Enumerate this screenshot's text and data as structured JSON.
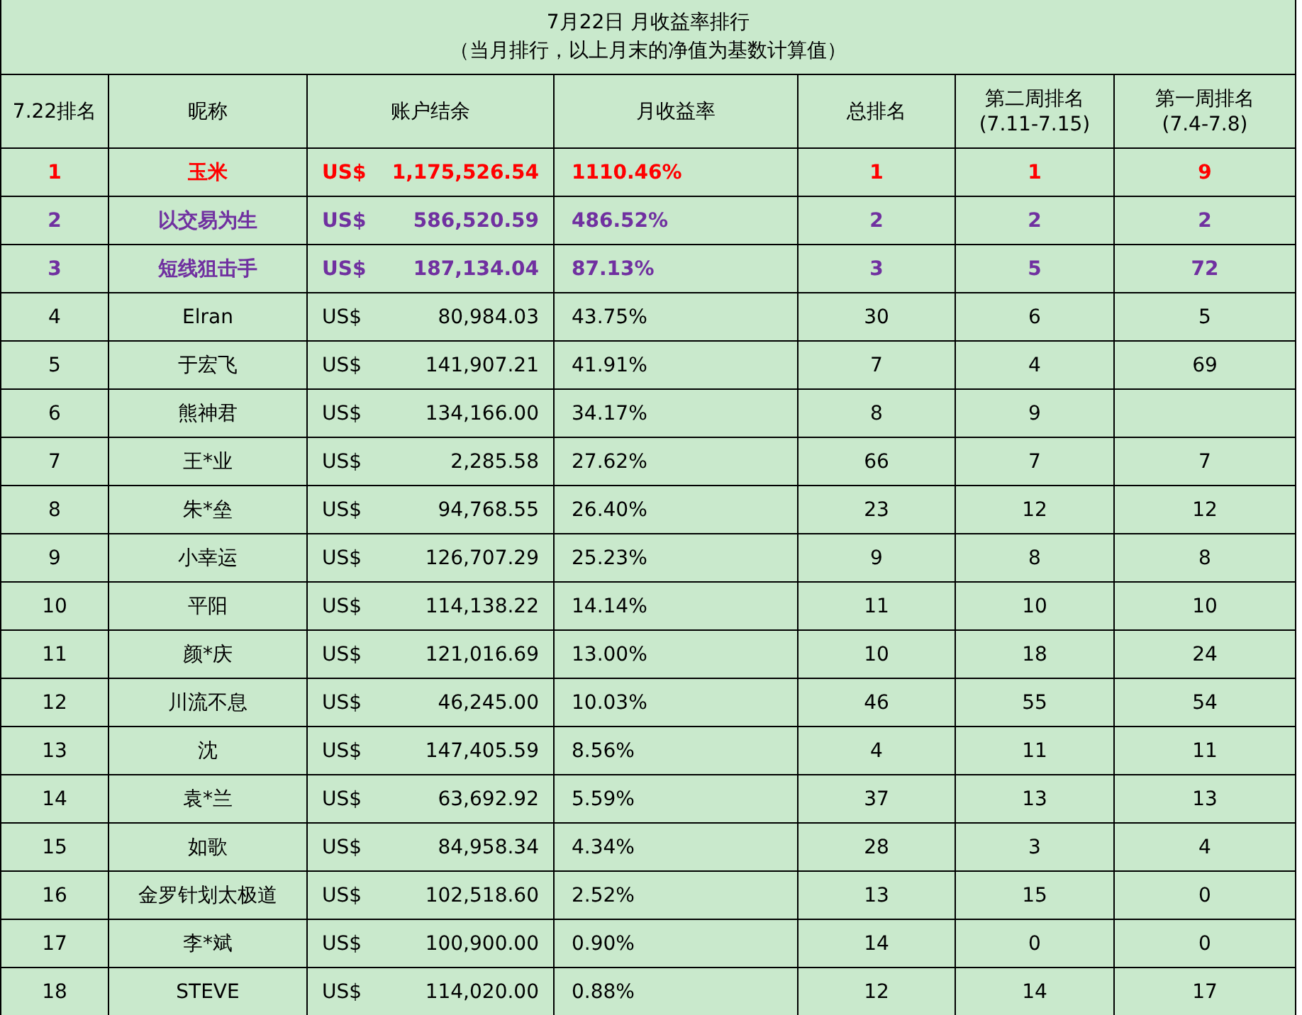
{
  "title": {
    "main": "7月22日 月收益率排行",
    "subtitle": "（当月排行，以上月末的净值为基数计算值）"
  },
  "columns": [
    {
      "label": "7.22排名"
    },
    {
      "label": "昵称"
    },
    {
      "label": "账户结余"
    },
    {
      "label": "月收益率"
    },
    {
      "label": "总排名"
    },
    {
      "label": "第二周排名",
      "sublabel": "(7.11-7.15)"
    },
    {
      "label": "第一周排名",
      "sublabel": "(7.4-7.8)"
    }
  ],
  "rows": [
    {
      "rank": "1",
      "nickname": "玉米",
      "currency": "US$",
      "balance": "1,175,526.54",
      "monthly_return": "1110.46%",
      "total_rank": "1",
      "week2_rank": "1",
      "week1_rank": "9",
      "color": "#ff0000",
      "highlighted": true
    },
    {
      "rank": "2",
      "nickname": "以交易为生",
      "currency": "US$",
      "balance": "586,520.59",
      "monthly_return": "486.52%",
      "total_rank": "2",
      "week2_rank": "2",
      "week1_rank": "2",
      "color": "#7030a0",
      "highlighted": true
    },
    {
      "rank": "3",
      "nickname": "短线狙击手",
      "currency": "US$",
      "balance": "187,134.04",
      "monthly_return": "87.13%",
      "total_rank": "3",
      "week2_rank": "5",
      "week1_rank": "72",
      "color": "#7030a0",
      "highlighted": true
    },
    {
      "rank": "4",
      "nickname": "Elran",
      "currency": "US$",
      "balance": "80,984.03",
      "monthly_return": "43.75%",
      "total_rank": "30",
      "week2_rank": "6",
      "week1_rank": "5",
      "color": "#000000",
      "highlighted": false
    },
    {
      "rank": "5",
      "nickname": "于宏飞",
      "currency": "US$",
      "balance": "141,907.21",
      "monthly_return": "41.91%",
      "total_rank": "7",
      "week2_rank": "4",
      "week1_rank": "69",
      "color": "#000000",
      "highlighted": false
    },
    {
      "rank": "6",
      "nickname": "熊神君",
      "currency": "US$",
      "balance": "134,166.00",
      "monthly_return": "34.17%",
      "total_rank": "8",
      "week2_rank": "9",
      "color": "#000000",
      "highlighted": false
    },
    {
      "rank": "7",
      "nickname": "王*业",
      "currency": "US$",
      "balance": "2,285.58",
      "monthly_return": "27.62%",
      "total_rank": "66",
      "week2_rank": "7",
      "week1_rank": "7",
      "color": "#000000",
      "highlighted": false
    },
    {
      "rank": "8",
      "nickname": "朱*垒",
      "currency": "US$",
      "balance": "94,768.55",
      "monthly_return": "26.40%",
      "total_rank": "23",
      "week2_rank": "12",
      "week1_rank": "12",
      "color": "#000000",
      "highlighted": false
    },
    {
      "rank": "9",
      "nickname": "小幸运",
      "currency": "US$",
      "balance": "126,707.29",
      "monthly_return": "25.23%",
      "total_rank": "9",
      "week2_rank": "8",
      "week1_rank": "8",
      "color": "#000000",
      "highlighted": false
    },
    {
      "rank": "10",
      "nickname": "平阳",
      "currency": "US$",
      "balance": "114,138.22",
      "monthly_return": "14.14%",
      "total_rank": "11",
      "week2_rank": "10",
      "week1_rank": "10",
      "color": "#000000",
      "highlighted": false
    },
    {
      "rank": "11",
      "nickname": "颜*庆",
      "currency": "US$",
      "balance": "121,016.69",
      "monthly_return": "13.00%",
      "total_rank": "10",
      "week2_rank": "18",
      "week1_rank": "24",
      "color": "#000000",
      "highlighted": false
    },
    {
      "rank": "12",
      "nickname": "川流不息",
      "currency": "US$",
      "balance": "46,245.00",
      "monthly_return": "10.03%",
      "total_rank": "46",
      "week2_rank": "55",
      "week1_rank": "54",
      "color": "#000000",
      "highlighted": false
    },
    {
      "rank": "13",
      "nickname": "沈",
      "currency": "US$",
      "balance": "147,405.59",
      "monthly_return": "8.56%",
      "total_rank": "4",
      "week2_rank": "11",
      "week1_rank": "11",
      "color": "#000000",
      "highlighted": false
    },
    {
      "rank": "14",
      "nickname": "袁*兰",
      "currency": "US$",
      "balance": "63,692.92",
      "monthly_return": "5.59%",
      "total_rank": "37",
      "week2_rank": "13",
      "week1_rank": "13",
      "color": "#000000",
      "highlighted": false
    },
    {
      "rank": "15",
      "nickname": "如歌",
      "currency": "US$",
      "balance": "84,958.34",
      "monthly_return": "4.34%",
      "total_rank": "28",
      "week2_rank": "3",
      "week1_rank": "4",
      "color": "#000000",
      "highlighted": false
    },
    {
      "rank": "16",
      "nickname": "金罗针划太极道",
      "currency": "US$",
      "balance": "102,518.60",
      "monthly_return": "2.52%",
      "total_rank": "13",
      "week2_rank": "15",
      "week1_rank": "0",
      "color": "#000000",
      "highlighted": false
    },
    {
      "rank": "17",
      "nickname": "李*斌",
      "currency": "US$",
      "balance": "100,900.00",
      "monthly_return": "0.90%",
      "total_rank": "14",
      "week2_rank": "0",
      "week1_rank": "0",
      "color": "#000000",
      "highlighted": false
    },
    {
      "rank": "18",
      "nickname": "STEVE",
      "currency": "US$",
      "balance": "114,020.00",
      "monthly_return": "0.88%",
      "total_rank": "12",
      "week2_rank": "14",
      "week1_rank": "17",
      "color": "#000000",
      "highlighted": false
    }
  ]
}
